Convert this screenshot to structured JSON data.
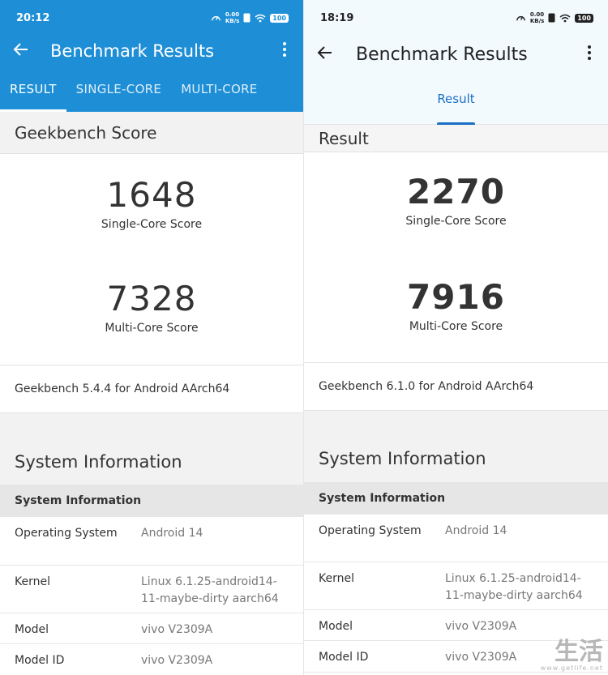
{
  "left": {
    "status": {
      "time": "20:12",
      "net_value": "0.00",
      "net_unit": "KB/s",
      "battery": "100"
    },
    "toolbar": {
      "title": "Benchmark Results"
    },
    "tabs": [
      {
        "label": "RESULT"
      },
      {
        "label": "SINGLE-CORE"
      },
      {
        "label": "MULTI-CORE"
      }
    ],
    "score_header": "Geekbench Score",
    "single_score": "1648",
    "single_label": "Single-Core Score",
    "multi_score": "7328",
    "multi_label": "Multi-Core Score",
    "version": "Geekbench 5.4.4 for Android AArch64",
    "sysinfo_title": "System Information",
    "sysinfo_subhead": "System Information",
    "rows": [
      {
        "key": "Operating System",
        "value": "Android 14"
      },
      {
        "key": "Kernel",
        "value": "Linux 6.1.25-android14-11-maybe-dirty aarch64"
      },
      {
        "key": "Model",
        "value": "vivo V2309A"
      },
      {
        "key": "Model ID",
        "value": "vivo V2309A"
      }
    ]
  },
  "right": {
    "status": {
      "time": "18:19",
      "net_value": "0.00",
      "net_unit": "KB/s",
      "battery": "100"
    },
    "toolbar": {
      "title": "Benchmark Results"
    },
    "tab": {
      "label": "Result"
    },
    "score_header": "Result",
    "single_score": "2270",
    "single_label": "Single-Core Score",
    "multi_score": "7916",
    "multi_label": "Multi-Core Score",
    "version": "Geekbench 6.1.0 for Android AArch64",
    "sysinfo_title": "System Information",
    "sysinfo_subhead": "System Information",
    "rows": [
      {
        "key": "Operating System",
        "value": "Android 14"
      },
      {
        "key": "Kernel",
        "value": "Linux 6.1.25-android14-11-maybe-dirty aarch64"
      },
      {
        "key": "Model",
        "value": "vivo V2309A"
      },
      {
        "key": "Model ID",
        "value": "vivo V2309A"
      }
    ]
  },
  "watermark": {
    "brand": "生活",
    "url": "www.getlife.net"
  },
  "colors": {
    "left_accent": "#1e8fd6",
    "right_accent": "#1a6fc4",
    "right_appbar": "#f3fafe"
  },
  "icons": {
    "back": "arrow-left-icon",
    "more": "more-vertical-icon",
    "speed": "speedometer-icon",
    "wifi": "wifi-icon",
    "battery": "battery-icon"
  }
}
